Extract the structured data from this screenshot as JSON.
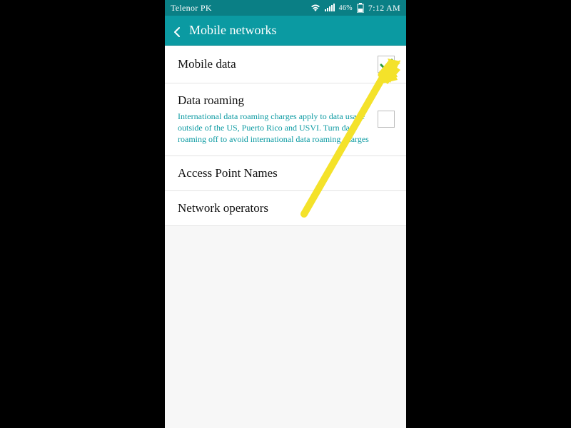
{
  "statusbar": {
    "carrier": "Telenor PK",
    "battery": "46%",
    "time": "7:12 AM"
  },
  "header": {
    "title": "Mobile networks"
  },
  "rows": {
    "mobile_data": {
      "title": "Mobile data",
      "checked": true
    },
    "data_roaming": {
      "title": "Data roaming",
      "desc": "International data roaming charges apply to data usage outside of the US, Puerto Rico and USVI. Turn data roaming off to avoid international data roaming charges",
      "checked": false
    },
    "apn": {
      "title": "Access Point Names"
    },
    "operators": {
      "title": "Network operators"
    }
  }
}
